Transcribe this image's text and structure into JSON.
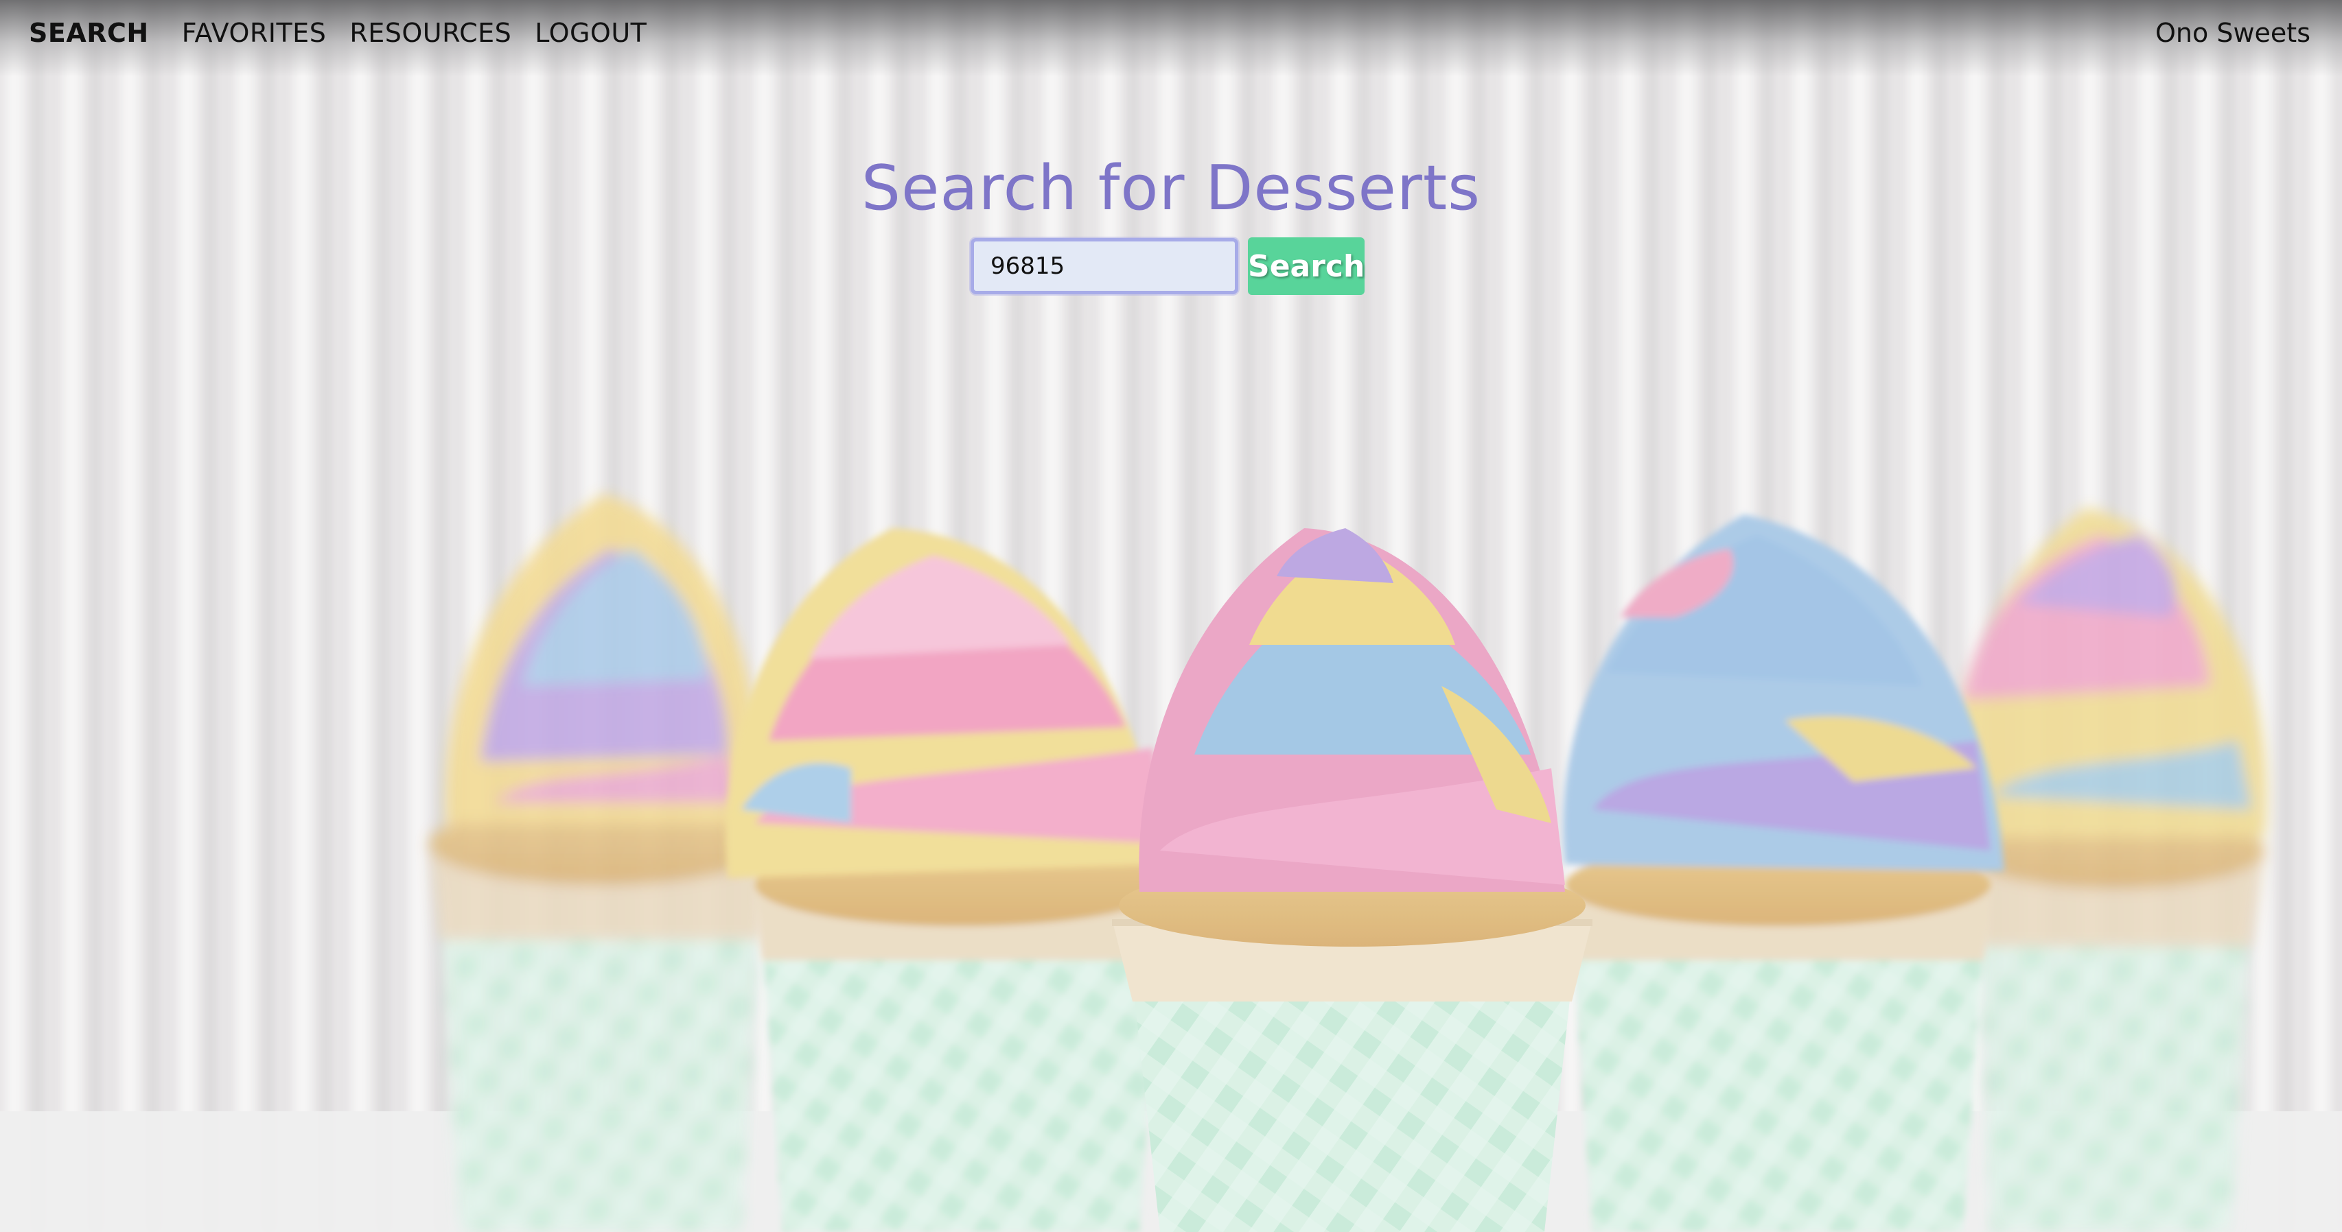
{
  "nav": {
    "items": [
      {
        "label": "SEARCH",
        "active": true
      },
      {
        "label": "FAVORITES",
        "active": false
      },
      {
        "label": "RESOURCES",
        "active": false
      },
      {
        "label": "LOGOUT",
        "active": false
      }
    ],
    "brand": "Ono Sweets"
  },
  "main": {
    "heading": "Search for Desserts",
    "search_value": "96815",
    "search_button_label": "Search"
  },
  "background": {
    "image": "rainbow-frosted-cupcakes-photo",
    "colors": {
      "heading": "#7e75c8",
      "button": "#58d49a",
      "input_bg": "#e3e9f6",
      "input_border": "#a7abe8",
      "liner_green": "#bfe6d2",
      "frosting_pink": "#f0a6c6",
      "frosting_blue": "#9dc3e3",
      "frosting_purple": "#b9a2e0",
      "frosting_yellow": "#eedc8a"
    }
  }
}
